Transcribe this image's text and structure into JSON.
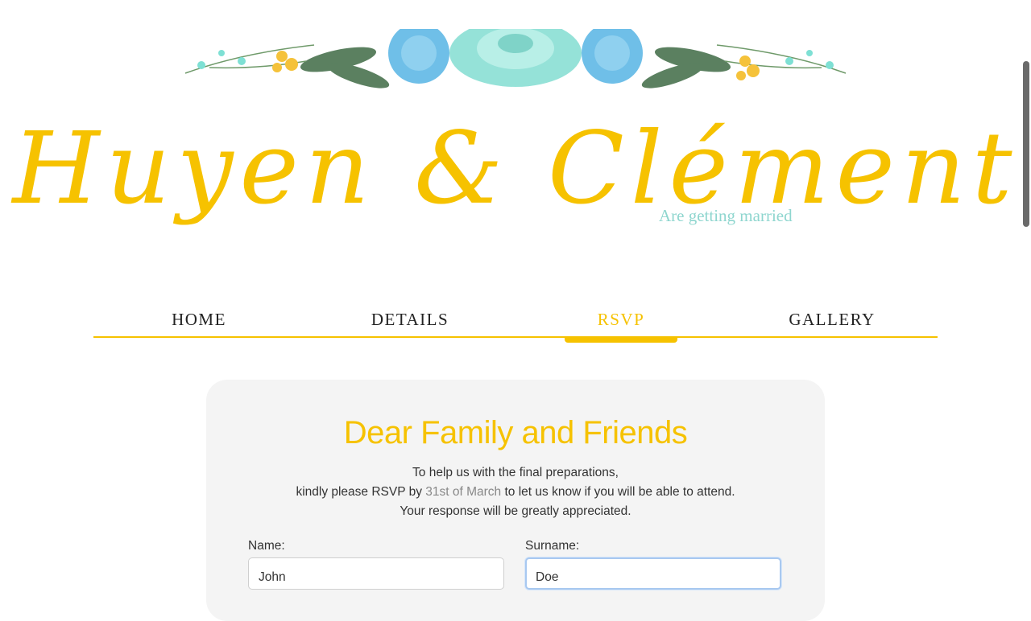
{
  "header": {
    "couple_names": "Huyen & Clément",
    "tagline": "Are getting married"
  },
  "nav": {
    "items": [
      {
        "label": "HOME"
      },
      {
        "label": "DETAILS"
      },
      {
        "label": "RSVP"
      },
      {
        "label": "GALLERY"
      }
    ],
    "active": "RSVP"
  },
  "rsvp": {
    "heading": "Dear Family and Friends",
    "line1": "To help us with the final preparations,",
    "line2_prefix": "kindly please RSVP by",
    "line2_date": "31st of March",
    "line2_suffix": "to let us know if you will be able to attend.",
    "line3": "Your response will be greatly appreciated.",
    "name_label": "Name:",
    "name_value": "John",
    "surname_label": "Surname:",
    "surname_value": "Doe"
  },
  "colors": {
    "accent": "#f6c200",
    "tagline": "#8fd6cf",
    "card_bg": "#f4f4f4"
  }
}
